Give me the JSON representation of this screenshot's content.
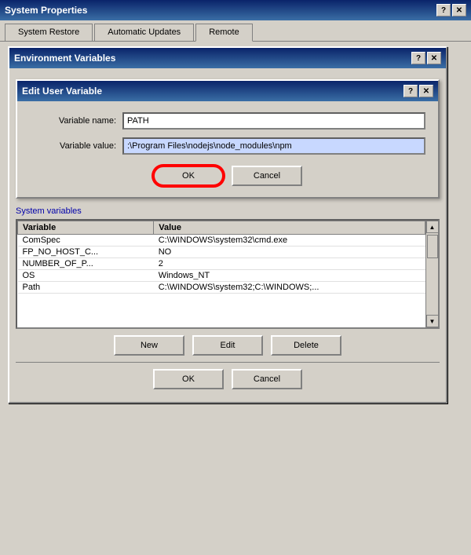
{
  "window": {
    "title": "System Properties",
    "help_btn": "?",
    "close_btn": "✕"
  },
  "tabs": [
    {
      "label": "System Restore",
      "active": false
    },
    {
      "label": "Automatic Updates",
      "active": false
    },
    {
      "label": "Remote",
      "active": true
    }
  ],
  "env_dialog": {
    "title": "Environment Variables",
    "help_btn": "?",
    "close_btn": "✕"
  },
  "edit_dialog": {
    "title": "Edit User Variable",
    "help_btn": "?",
    "close_btn": "✕",
    "variable_name_label": "Variable name:",
    "variable_value_label": "Variable value:",
    "variable_name_value": "PATH",
    "variable_value_value": ":\\Program Files\\nodejs\\node_modules\\npm",
    "ok_label": "OK",
    "cancel_label": "Cancel"
  },
  "system_variables": {
    "section_label": "System variables",
    "columns": [
      "Variable",
      "Value"
    ],
    "rows": [
      {
        "variable": "ComSpec",
        "value": "C:\\WINDOWS\\system32\\cmd.exe"
      },
      {
        "variable": "FP_NO_HOST_C...",
        "value": "NO"
      },
      {
        "variable": "NUMBER_OF_P...",
        "value": "2"
      },
      {
        "variable": "OS",
        "value": "Windows_NT"
      },
      {
        "variable": "Path",
        "value": "C:\\WINDOWS\\system32;C:\\WINDOWS;..."
      }
    ],
    "new_label": "New",
    "edit_label": "Edit",
    "delete_label": "Delete"
  },
  "bottom_buttons": {
    "ok_label": "OK",
    "cancel_label": "Cancel"
  }
}
